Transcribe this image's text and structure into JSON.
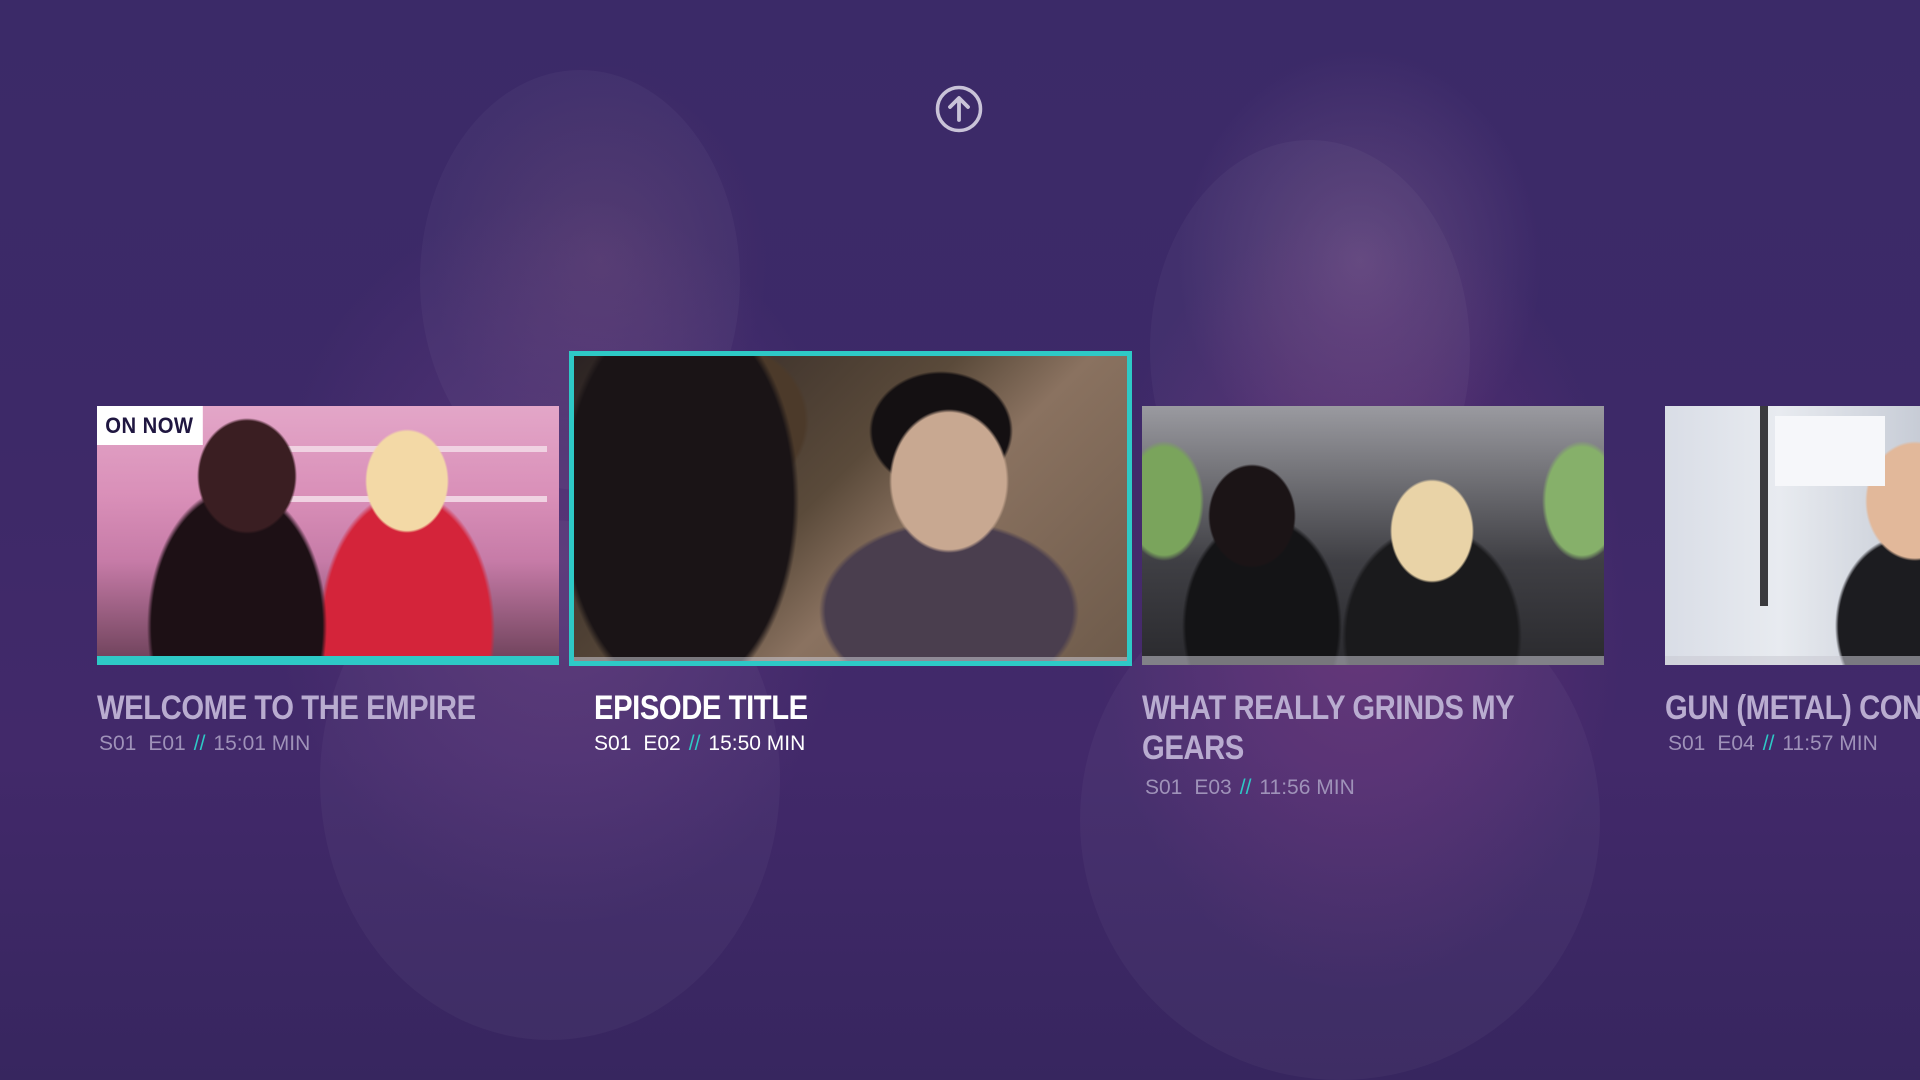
{
  "navigation": {
    "up_icon": "arrow-up-circle-icon"
  },
  "colors": {
    "accent": "#2ec9c6",
    "background": "#3b2a68",
    "title_inactive": "#b9acd0",
    "meta_inactive": "#9f92b9"
  },
  "episodes": [
    {
      "title": "WELCOME TO THE EMPIRE",
      "season": "S01",
      "episode": "E01",
      "separator": "//",
      "duration": "15:01 MIN",
      "badge": "ON NOW",
      "progress": 1.0
    },
    {
      "title": "EPISODE TITLE",
      "season": "S01",
      "episode": "E02",
      "separator": "//",
      "duration": "15:50 MIN",
      "progress": 0.0
    },
    {
      "title_line1": "WHAT REALLY GRINDS MY",
      "title_line2": "GEARS",
      "season": "S01",
      "episode": "E03",
      "separator": "//",
      "duration": "11:56 MIN",
      "progress": 0.0
    },
    {
      "title": "GUN (METAL) CON",
      "season": "S01",
      "episode": "E04",
      "separator": "//",
      "duration": "11:57 MIN",
      "progress": 0.0
    }
  ]
}
